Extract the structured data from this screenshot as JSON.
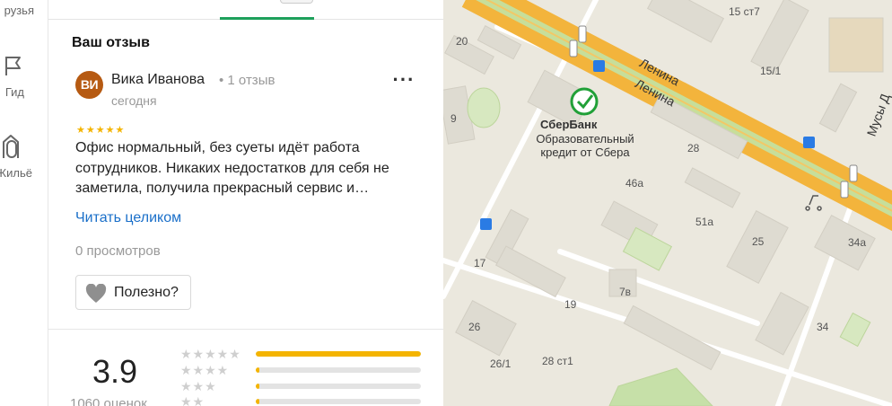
{
  "rail": {
    "friends_label": "рузья",
    "guide_label": "Гид",
    "housing_label": "Жильё"
  },
  "review": {
    "section_title": "Ваш отзыв",
    "avatar_initials": "ВИ",
    "avatar_color": "#b65a12",
    "author": "Вика Иванова",
    "author_reviews": "• 1 отзыв",
    "date": "сегодня",
    "more_icon": "more-dots-icon",
    "stars": "★★★★★",
    "rating": 5,
    "text": "Офис нормальный, без суеты идёт работа сотрудников. Никаких недостатков для себя не заметила, получила прекрасный сервис и…",
    "read_more": "Читать целиком",
    "views": "0 просмотров",
    "helpful_label": "Полезно?",
    "helpful_icon": "heart-icon"
  },
  "summary": {
    "rating_value": "3.9",
    "rating_count": "1060 оценок",
    "histogram": [
      {
        "stars": "★★★★★",
        "fraction": 1.0
      },
      {
        "stars": "★★★★",
        "fraction": 0.02
      },
      {
        "stars": "★★★",
        "fraction": 0.02
      },
      {
        "stars": "★★",
        "fraction": 0.02
      }
    ],
    "accent_color": "#f4b400"
  },
  "map": {
    "streets": [
      "Ленина",
      "Ленина",
      "Мусы Д"
    ],
    "poi": {
      "name": "СберБанк",
      "description": "Образовательный кредит от Сбера",
      "icon": "sberbank-logo-icon"
    },
    "house_numbers": [
      "15 ст7",
      "20",
      "15/1",
      "9",
      "28",
      "46а",
      "51а",
      "25",
      "34а",
      "17",
      "7в",
      "19",
      "26",
      "34",
      "26/1",
      "28 ст1"
    ]
  }
}
